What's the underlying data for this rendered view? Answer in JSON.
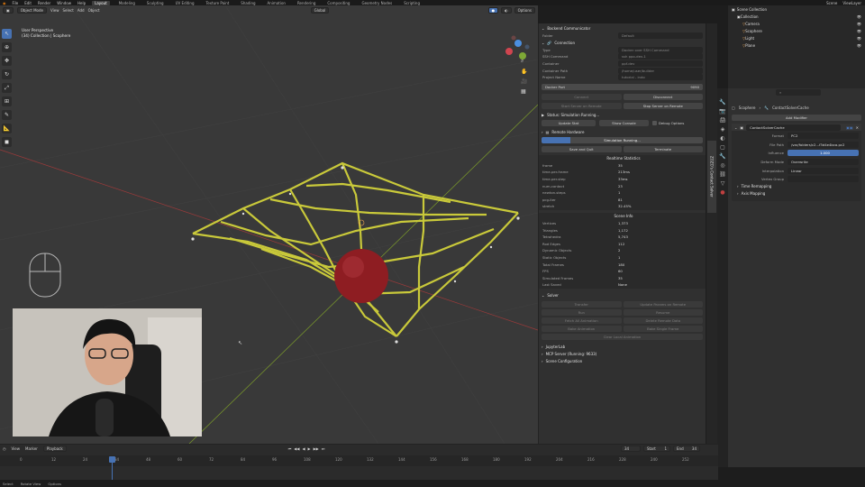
{
  "menu": {
    "items": [
      "File",
      "Edit",
      "Render",
      "Window",
      "Help"
    ],
    "workspaces": [
      "Layout",
      "Modeling",
      "Sculpting",
      "UV Editing",
      "Texture Paint",
      "Shading",
      "Animation",
      "Rendering",
      "Compositing",
      "Geometry Nodes",
      "Scripting"
    ],
    "active_workspace": "Layout",
    "scene_name": "Scene",
    "view_layer": "ViewLayer"
  },
  "viewport": {
    "mode": "Object Mode",
    "menus": [
      "View",
      "Select",
      "Add",
      "Object"
    ],
    "transform": "Global",
    "options_label": "Options",
    "info_line1": "User Perspective",
    "info_line2": "(34) Collection | Scophere"
  },
  "backend": {
    "title": "Backend Communicator",
    "folder_label": "Folder",
    "folder_value": "Default",
    "connection_title": "Connection",
    "connection_rows": [
      {
        "k": "Type",
        "v": "Docker over SSH Command"
      },
      {
        "k": "SSH Command",
        "v": "ssh ppo-dev-1"
      },
      {
        "k": "Container",
        "v": "ppf-dev"
      },
      {
        "k": "Container Path",
        "v": "/home/user/builder"
      },
      {
        "k": "Project Name",
        "v": "tutorial - indo"
      }
    ],
    "docker_port_label": "Docker Port",
    "docker_port_value": "9090",
    "connect": "Connect",
    "disconnect": "Disconnect",
    "start_server": "Start Server on Remote",
    "stop_server": "Stop Server on Remote",
    "status_label": "Status: Simulation Running...",
    "update_stat": "Update Stat",
    "show_console": "Show Console",
    "debug_options": "Debug Options",
    "remote_hardware": "Remote Hardware",
    "sim_running": "Simulation Running...",
    "sim_progress": 0.18,
    "save_quit": "Save and Quit",
    "terminate": "Terminate",
    "realtime_title": "Realtime Statistics",
    "realtime": [
      {
        "k": "frame",
        "v": "35"
      },
      {
        "k": "time-per-frame",
        "v": "213ms"
      },
      {
        "k": "time-per-step",
        "v": "33ms"
      },
      {
        "k": "num-contact",
        "v": "23"
      },
      {
        "k": "newton-steps",
        "v": "1"
      },
      {
        "k": "pcg-iter",
        "v": "81"
      },
      {
        "k": "stretch",
        "v": "32.45%"
      }
    ],
    "scene_info_title": "Scene Info",
    "scene_info": [
      {
        "k": "Vertices",
        "v": "1,373"
      },
      {
        "k": "Triangles",
        "v": "1,172"
      },
      {
        "k": "Tetrahedra",
        "v": "5,743"
      },
      {
        "k": "Rod Edges",
        "v": "112"
      },
      {
        "k": "Dynamic Objects",
        "v": "2"
      },
      {
        "k": "Static Objects",
        "v": "1"
      },
      {
        "k": "Total Frames",
        "v": "180"
      },
      {
        "k": "FPS",
        "v": "60"
      },
      {
        "k": "Simulated Frames",
        "v": "35"
      },
      {
        "k": "Last Saved",
        "v": "None"
      }
    ],
    "solver_title": "Solver",
    "solver_buttons": [
      [
        "Transfer",
        "Update Params on Remote"
      ],
      [
        "Run",
        "Resume"
      ],
      [
        "Fetch All Animation",
        "Delete Remote Data"
      ],
      [
        "Bake Animation",
        "Bake Single Frame"
      ]
    ],
    "clear_local": "Clear Local Animation",
    "jupyter": "JupyterLab",
    "mcp": "MCP Server (Running: 9633)",
    "scene_config": "Scene Configuration",
    "vertical_tab": "ZOZO's Contact Solver"
  },
  "outliner": {
    "title": "Scene Collection",
    "items": [
      {
        "label": "Collection",
        "indent": 1
      },
      {
        "label": "Camera",
        "indent": 2
      },
      {
        "label": "Scophere",
        "indent": 2
      },
      {
        "label": "Light",
        "indent": 2
      },
      {
        "label": "Plane",
        "indent": 2
      }
    ]
  },
  "properties": {
    "breadcrumb_obj": "Scophere",
    "breadcrumb_mod": "ContactSolverCache",
    "add_modifier": "Add Modifier",
    "modifier_name": "ContactSolverCache",
    "rows": [
      {
        "k": "Format",
        "v": "PC2"
      },
      {
        "k": "File Path",
        "v": "/var/folders/c2...f3d4e4bca.pc2"
      },
      {
        "k": "Influence",
        "v": "1.000"
      },
      {
        "k": "Deform Mode",
        "v": "Overwrite"
      },
      {
        "k": "Interpolation",
        "v": "Linear"
      },
      {
        "k": "Vertex Group",
        "v": ""
      }
    ],
    "time_remapping": "Time Remapping",
    "axis_mapping": "Axis Mapping"
  },
  "timeline": {
    "menus": [
      "View",
      "Marker",
      "Playback"
    ],
    "current_frame": "34",
    "start_label": "Start",
    "start": "1",
    "end_label": "End",
    "end": "34",
    "ticks": [
      "0",
      "12",
      "24",
      "34",
      "48",
      "60",
      "72",
      "84",
      "96",
      "108",
      "120",
      "132",
      "144",
      "156",
      "168",
      "180",
      "192",
      "204",
      "216",
      "228",
      "240",
      "252"
    ]
  },
  "statusbar": {
    "items": [
      "Select",
      "Rotate View",
      "Options"
    ]
  },
  "colors": {
    "accent": "#4772b3",
    "mesh": "#c9c93a",
    "sphere": "#8e1d22",
    "grid_x": "#9b3a3a",
    "grid_y": "#7b9a2b"
  }
}
